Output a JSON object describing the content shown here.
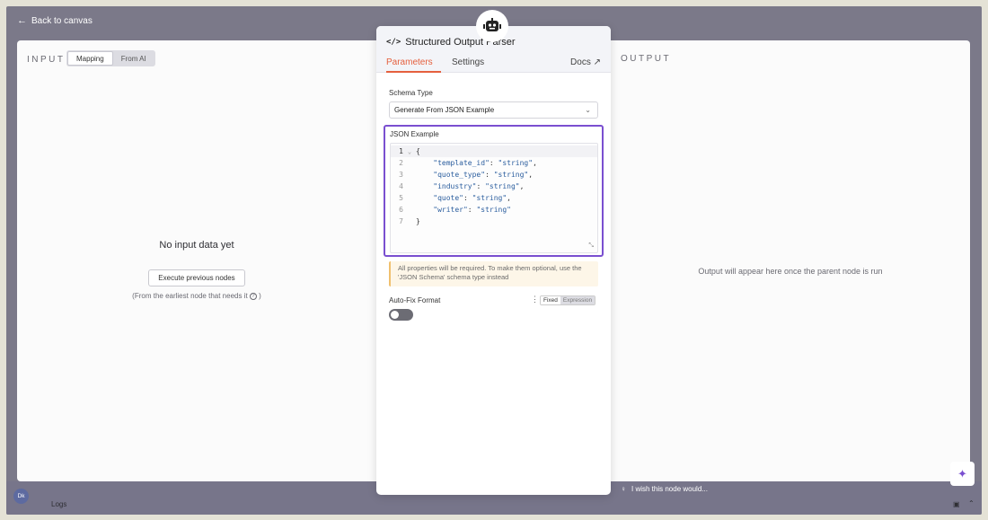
{
  "nav": {
    "back_label": "Back to canvas"
  },
  "input_panel": {
    "title": "INPUT",
    "tabs": [
      "Mapping",
      "From AI"
    ],
    "empty_title": "No input data yet",
    "execute_label": "Execute previous nodes",
    "hint_prefix": "(From the earliest node that needs it",
    "hint_suffix": ")"
  },
  "output_panel": {
    "title": "OUTPUT",
    "message": "Output will appear here once the parent node is run"
  },
  "node": {
    "title": "Structured Output Parser",
    "tabs": {
      "parameters": "Parameters",
      "settings": "Settings",
      "docs": "Docs"
    },
    "schema_type": {
      "label": "Schema Type",
      "value": "Generate From JSON Example"
    },
    "json_example": {
      "label": "JSON Example",
      "lines": [
        {
          "n": "1",
          "text": "{"
        },
        {
          "n": "2",
          "key": "\"template_id\"",
          "val": "\"string\"",
          "comma": ","
        },
        {
          "n": "3",
          "key": "\"quote_type\"",
          "val": "\"string\"",
          "comma": ","
        },
        {
          "n": "4",
          "key": "\"industry\"",
          "val": "\"string\"",
          "comma": ","
        },
        {
          "n": "5",
          "key": "\"quote\"",
          "val": "\"string\"",
          "comma": ","
        },
        {
          "n": "6",
          "key": "\"writer\"",
          "val": "\"string\"",
          "comma": ""
        },
        {
          "n": "7",
          "text": "}"
        }
      ]
    },
    "notice": "All properties will be required. To make them optional, use the 'JSON Schema' schema type instead",
    "autofix": {
      "label": "Auto-Fix Format",
      "fixed": "Fixed",
      "expression": "Expression",
      "enabled": false
    }
  },
  "footer": {
    "wish_label": "I wish this node would...",
    "logs_label": "Logs",
    "avatar_initials": "Dk"
  },
  "colors": {
    "accent": "#e5603e",
    "focus": "#7a4fd0",
    "overlay": "#7b7989"
  }
}
